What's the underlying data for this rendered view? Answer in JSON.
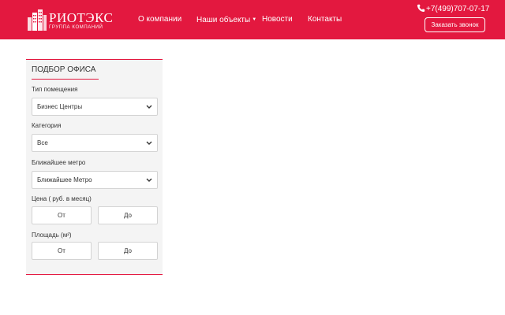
{
  "brand": {
    "name": "РИОТЭКС",
    "tagline": "ГРУППА КОМПАНИЙ",
    "color": "#e3183f"
  },
  "nav": {
    "items": [
      {
        "label": "О компании"
      },
      {
        "label": "Наши объекты",
        "has_dropdown": true
      },
      {
        "label": "Новости"
      },
      {
        "label": "Контакты"
      }
    ]
  },
  "contact": {
    "phone": "+7(499)707-07-17",
    "phone_icon": "phone-icon",
    "callback_label": "Заказать звонок"
  },
  "filter": {
    "title": "ПОДБОР ОФИСА",
    "room_type": {
      "label": "Тип помещения",
      "value": "Бизнес Центры"
    },
    "category": {
      "label": "Категория",
      "value": "Все"
    },
    "metro": {
      "label": "Ближайшее метро",
      "value": "Ближайшее Метро"
    },
    "price": {
      "label": "Цена ( руб. в месяц)",
      "from": "От",
      "to": "До"
    },
    "area": {
      "label": "Площадь (м²)",
      "from": "От",
      "to": "До"
    }
  }
}
